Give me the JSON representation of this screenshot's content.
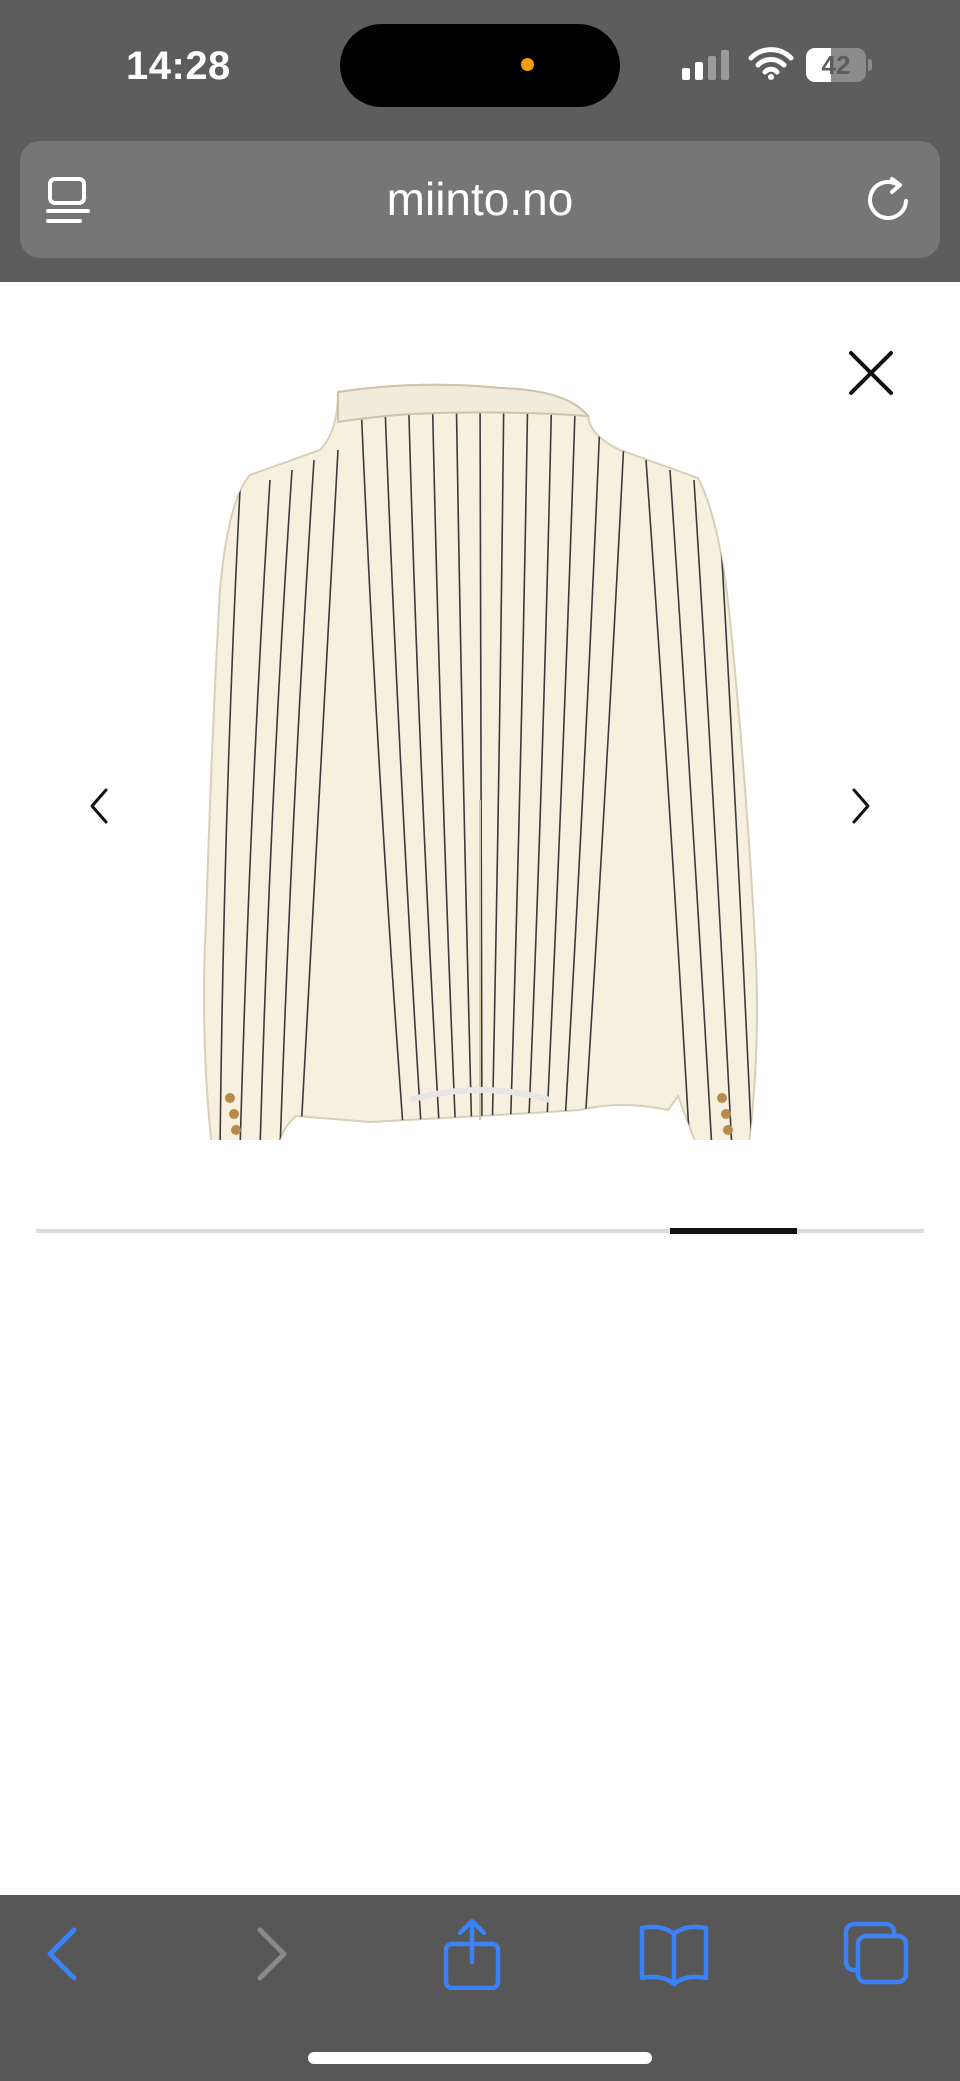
{
  "status_bar": {
    "time": "14:28",
    "battery_level": "42",
    "battery_fraction": 0.42,
    "icons": [
      "cellular-signal-icon",
      "wifi-icon",
      "battery-icon"
    ]
  },
  "browser": {
    "url": "miinto.no",
    "icons": [
      "reader-icon",
      "reload-icon"
    ]
  },
  "gallery": {
    "image_alt": "Cream pinstripe blazer, back view",
    "icons": [
      "close-icon",
      "chevron-left-icon",
      "chevron-right-icon"
    ],
    "progress_start": 0.714,
    "progress_end": 0.857
  },
  "toolbar": {
    "icons": [
      "back-icon",
      "forward-icon",
      "share-icon",
      "bookmarks-icon",
      "tabs-icon"
    ]
  },
  "colors": {
    "chrome": "#5d5d5d",
    "accent_blue": "#3b82f6",
    "blazer": "#f7f0df",
    "stripe": "#3a3a3a"
  }
}
